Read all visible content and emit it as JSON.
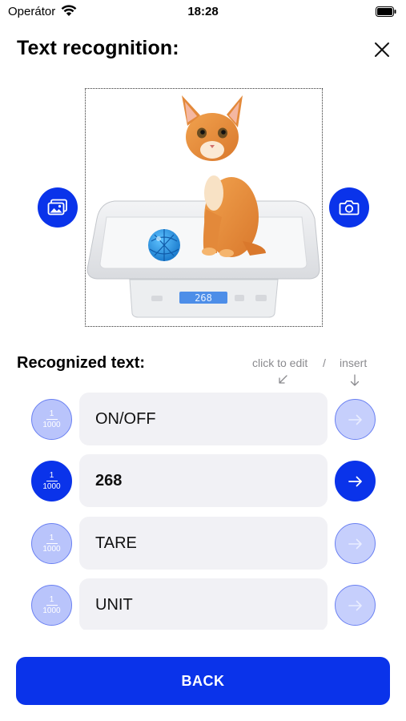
{
  "status_bar": {
    "carrier": "Operátor",
    "time": "18:28"
  },
  "header": {
    "title": "Text recognition:",
    "close_icon": "close-icon"
  },
  "image": {
    "scale_display": "268"
  },
  "recognized": {
    "title": "Recognized text:",
    "hint_edit": "click to edit",
    "hint_separator": "/",
    "hint_insert": "insert",
    "rows": [
      {
        "numerator": "1",
        "denominator": "1000",
        "text": "ON/OFF",
        "active": false
      },
      {
        "numerator": "1",
        "denominator": "1000",
        "text": "268",
        "active": true
      },
      {
        "numerator": "1",
        "denominator": "1000",
        "text": "TARE",
        "active": false
      },
      {
        "numerator": "1",
        "denominator": "1000",
        "text": "UNIT",
        "active": false
      }
    ]
  },
  "footer": {
    "back_label": "BACK"
  },
  "colors": {
    "accent": "#0a33ea",
    "accent_light": "#b9c4fb",
    "field_bg": "#f1f1f5",
    "hint": "#8a8a8e"
  }
}
